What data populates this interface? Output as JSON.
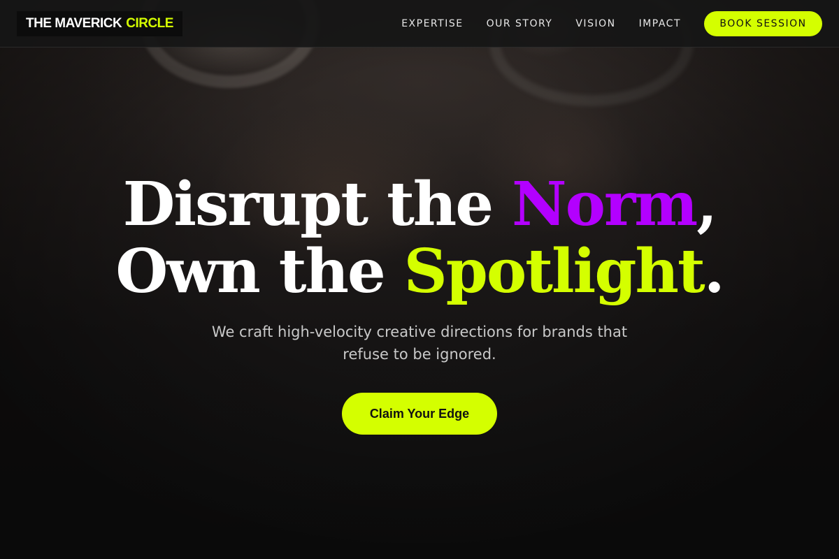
{
  "brand": {
    "name_main": "THE MAVERICK",
    "name_accent": "CIRCLE"
  },
  "nav": {
    "items": [
      {
        "label": "EXPERTISE"
      },
      {
        "label": "OUR STORY"
      },
      {
        "label": "VISION"
      },
      {
        "label": "IMPACT"
      }
    ],
    "cta_label": "BOOK SESSION"
  },
  "hero": {
    "headline_line1_a": "Disrupt the ",
    "headline_line1_highlight": "Norm",
    "headline_line1_b": ",",
    "headline_line2_a": "Own the ",
    "headline_line2_highlight": "Spotlight",
    "headline_line2_b": ".",
    "subtitle": "We craft high-velocity creative directions for brands that refuse to be ignored.",
    "cta_label": "Claim Your Edge"
  },
  "colors": {
    "accent_lime": "#d4ff00",
    "accent_purple": "#b300ff",
    "background": "#111111",
    "text": "#ffffff"
  }
}
